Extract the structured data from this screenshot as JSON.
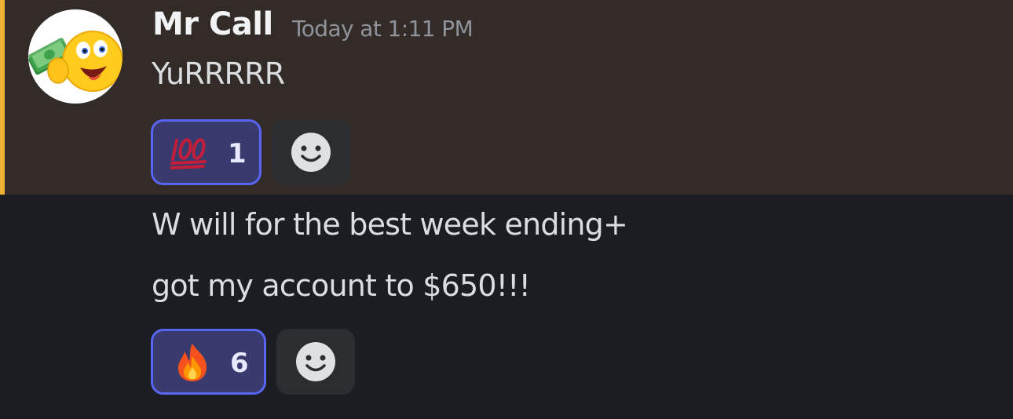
{
  "message": {
    "username": "Mr Call",
    "timestamp": "Today at 1:11 PM",
    "text": "YuRRRRR",
    "avatar_icon": "money-emoji-avatar",
    "highlight_color": "#f0b232",
    "reaction": {
      "emoji": "hundred-points-emoji",
      "count": "1"
    }
  },
  "followup": {
    "line1": "W will for the best week ending+",
    "line2": "got my account to $650!!!",
    "reaction": {
      "emoji": "fire-emoji",
      "count": "6"
    }
  },
  "colors": {
    "background": "#1c1d22",
    "highlight_background": "#332b27",
    "reaction_border": "#5865f2",
    "reaction_background": "#393a6e"
  }
}
